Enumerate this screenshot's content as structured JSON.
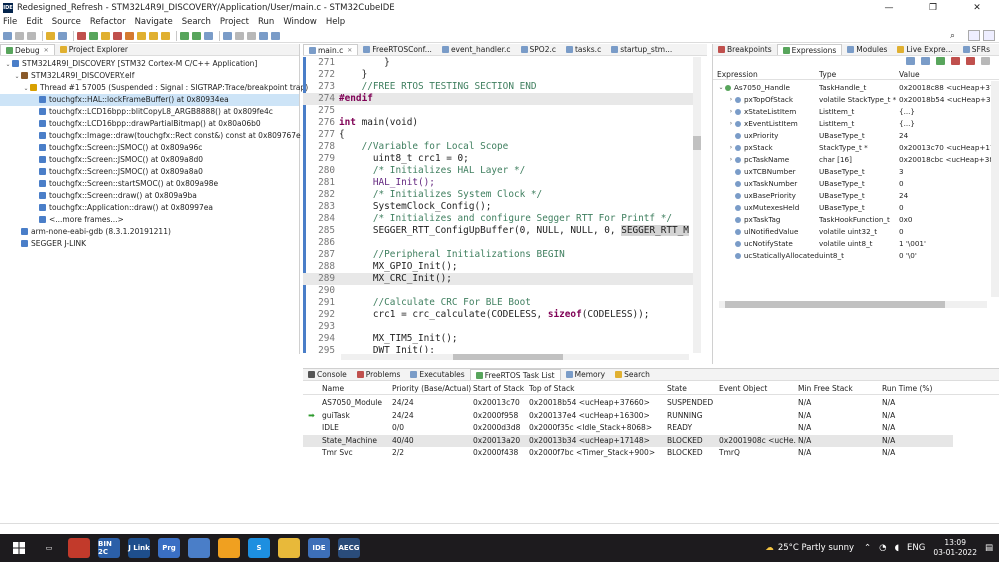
{
  "window": {
    "title": "Redesigned_Refresh - STM32L4R9I_DISCOVERY/Application/User/main.c - STM32CubeIDE",
    "minimize": "—",
    "maximize": "❐",
    "close": "✕"
  },
  "menu": [
    "File",
    "Edit",
    "Source",
    "Refactor",
    "Navigate",
    "Search",
    "Project",
    "Run",
    "Window",
    "Help"
  ],
  "left_tabs": {
    "debug": "Debug",
    "explorer": "Project Explorer"
  },
  "debug_tree": [
    {
      "indent": 0,
      "tw": "⌄",
      "text": "STM32L4R9I_DISCOVERY [STM32 Cortex-M C/C++ Application]",
      "icon": "#4a7ec8"
    },
    {
      "indent": 1,
      "tw": "⌄",
      "text": "STM32L4R9I_DISCOVERY.elf",
      "icon": "#8a5a2a"
    },
    {
      "indent": 2,
      "tw": "⌄",
      "text": "Thread #1 57005 (Suspended : Signal : SIGTRAP:Trace/breakpoint trap)",
      "icon": "#d8a000"
    },
    {
      "indent": 3,
      "tw": "",
      "text": "touchgfx::HAL::lockFrameBuffer() at 0x80934ea",
      "icon": "#4a7ec8",
      "sel": true
    },
    {
      "indent": 3,
      "tw": "",
      "text": "touchgfx::LCD16bpp::blitCopyL8_ARGB8888() at 0x809fe4c",
      "icon": "#4a7ec8"
    },
    {
      "indent": 3,
      "tw": "",
      "text": "touchgfx::LCD16bpp::drawPartialBitmap() at 0x80a06b0",
      "icon": "#4a7ec8"
    },
    {
      "indent": 3,
      "tw": "",
      "text": "touchgfx::Image::draw(touchgfx::Rect const&) const at 0x809767e",
      "icon": "#4a7ec8"
    },
    {
      "indent": 3,
      "tw": "",
      "text": "touchgfx::Screen::JSMOC() at 0x809a96c",
      "icon": "#4a7ec8"
    },
    {
      "indent": 3,
      "tw": "",
      "text": "touchgfx::Screen::JSMOC() at 0x809a8d0",
      "icon": "#4a7ec8"
    },
    {
      "indent": 3,
      "tw": "",
      "text": "touchgfx::Screen::JSMOC() at 0x809a8a0",
      "icon": "#4a7ec8"
    },
    {
      "indent": 3,
      "tw": "",
      "text": "touchgfx::Screen::startSMOC() at 0x809a98e",
      "icon": "#4a7ec8"
    },
    {
      "indent": 3,
      "tw": "",
      "text": "touchgfx::Screen::draw() at 0x809a9ba",
      "icon": "#4a7ec8"
    },
    {
      "indent": 3,
      "tw": "",
      "text": "touchgfx::Application::draw() at 0x80997ea",
      "icon": "#4a7ec8"
    },
    {
      "indent": 3,
      "tw": "",
      "text": "<...more frames...>",
      "icon": "#4a7ec8"
    },
    {
      "indent": 1,
      "tw": "",
      "text": "arm-none-eabi-gdb (8.3.1.20191211)",
      "icon": "#4a7ec8"
    },
    {
      "indent": 1,
      "tw": "",
      "text": "SEGGER J-LINK",
      "icon": "#4a7ec8"
    }
  ],
  "editor_tabs": [
    "main.c",
    "FreeRTOSConf...",
    "event_handler.c",
    "SPO2.c",
    "tasks.c",
    "startup_stm..."
  ],
  "code": [
    {
      "n": "271",
      "t": "        }"
    },
    {
      "n": "272",
      "t": "    }"
    },
    {
      "n": "273",
      "t": "    //FREE RTOS TESTING SECTION END",
      "c": "cm"
    },
    {
      "n": "274",
      "t": "#endif",
      "c": "pp",
      "hl": true
    },
    {
      "n": "275",
      "t": ""
    },
    {
      "n": "276",
      "t": "int main(void)",
      "k": "int"
    },
    {
      "n": "277",
      "t": "{"
    },
    {
      "n": "278",
      "t": "    //Variable for Local Scope",
      "c": "cm"
    },
    {
      "n": "279",
      "t": "      uint8_t crc1 = 0;"
    },
    {
      "n": "280",
      "t": "      /* Initializes HAL Layer */",
      "c": "cm"
    },
    {
      "n": "281",
      "t": "      HAL_Init();",
      "c": "mc"
    },
    {
      "n": "282",
      "t": "      /* Initializes System Clock */",
      "c": "cm"
    },
    {
      "n": "283",
      "t": "      SystemClock_Config();"
    },
    {
      "n": "284",
      "t": "      /* Initializes and configure Segger RTT For Printf */",
      "c": "cm"
    },
    {
      "n": "285",
      "t": "      SEGGER_RTT_ConfigUpBuffer(0, NULL, NULL, 0, SEGGER_RTT_M"
    },
    {
      "n": "286",
      "t": ""
    },
    {
      "n": "287",
      "t": "      //Peripheral Initializations BEGIN",
      "c": "cm"
    },
    {
      "n": "288",
      "t": "      MX_GPIO_Init();"
    },
    {
      "n": "289",
      "t": "      MX_CRC_Init();",
      "hl": true
    },
    {
      "n": "290",
      "t": ""
    },
    {
      "n": "291",
      "t": "      //Calculate CRC For BLE Boot",
      "c": "cm"
    },
    {
      "n": "292",
      "t": "      crc1 = crc_calculate(CODELESS, sizeof(CODELESS));"
    },
    {
      "n": "293",
      "t": ""
    },
    {
      "n": "294",
      "t": "      MX_TIM5_Init();"
    },
    {
      "n": "295",
      "t": "      DWT_Init();"
    }
  ],
  "right_tabs": [
    "Breakpoints",
    "Expressions",
    "Modules",
    "Live Expre...",
    "SFRs"
  ],
  "expr_headers": {
    "expr": "Expression",
    "type": "Type",
    "value": "Value"
  },
  "expr_rows": [
    {
      "tw": "⌄",
      "name": "As7050_Handle",
      "type": "TaskHandle_t",
      "value": "0x20018c88 <ucHeap+379",
      "lvl": 0
    },
    {
      "tw": "›",
      "name": "pxTopOfStack",
      "type": "volatile StackType_t *",
      "value": "0x20018b54 <ucHeap+37",
      "lvl": 1
    },
    {
      "tw": "›",
      "name": "xStateListItem",
      "type": "ListItem_t",
      "value": "{...}",
      "lvl": 1
    },
    {
      "tw": "›",
      "name": "xEventListItem",
      "type": "ListItem_t",
      "value": "{...}",
      "lvl": 1
    },
    {
      "tw": "",
      "name": "uxPriority",
      "type": "UBaseType_t",
      "value": "24",
      "lvl": 1
    },
    {
      "tw": "›",
      "name": "pxStack",
      "type": "StackType_t *",
      "value": "0x20013c70 <ucHeap+174",
      "lvl": 1
    },
    {
      "tw": "›",
      "name": "pcTaskName",
      "type": "char [16]",
      "value": "0x20018cbc <ucHeap+380",
      "lvl": 1
    },
    {
      "tw": "",
      "name": "uxTCBNumber",
      "type": "UBaseType_t",
      "value": "3",
      "lvl": 1
    },
    {
      "tw": "",
      "name": "uxTaskNumber",
      "type": "UBaseType_t",
      "value": "0",
      "lvl": 1
    },
    {
      "tw": "",
      "name": "uxBasePriority",
      "type": "UBaseType_t",
      "value": "24",
      "lvl": 1
    },
    {
      "tw": "",
      "name": "uxMutexesHeld",
      "type": "UBaseType_t",
      "value": "0",
      "lvl": 1
    },
    {
      "tw": "",
      "name": "pxTaskTag",
      "type": "TaskHookFunction_t",
      "value": "0x0",
      "lvl": 1
    },
    {
      "tw": "",
      "name": "ulNotifiedValue",
      "type": "volatile uint32_t",
      "value": "0",
      "lvl": 1
    },
    {
      "tw": "",
      "name": "ucNotifyState",
      "type": "volatile uint8_t",
      "value": "1 '\\001'",
      "lvl": 1
    },
    {
      "tw": "",
      "name": "ucStaticallyAllocated",
      "type": "uint8_t",
      "value": "0 '\\0'",
      "lvl": 1
    }
  ],
  "bottom_tabs": [
    "Console",
    "Problems",
    "Executables",
    "FreeRTOS Task List",
    "Memory",
    "Search"
  ],
  "task_headers": [
    "Name",
    "Priority (Base/Actual)",
    "Start of Stack",
    "Top of Stack",
    "State",
    "Event Object",
    "Min Free Stack",
    "Run Time (%)"
  ],
  "tasks": [
    {
      "name": "AS7050_Module",
      "prio": "24/24",
      "start": "0x20013c70",
      "top": "0x20018b54 <ucHeap+37660>",
      "state": "SUSPENDED",
      "event": "",
      "min": "N/A",
      "run": "N/A"
    },
    {
      "name": "guiTask",
      "prio": "24/24",
      "start": "0x2000f958",
      "top": "0x200137e4 <ucHeap+16300>",
      "state": "RUNNING",
      "event": "",
      "min": "N/A",
      "run": "N/A",
      "running": true
    },
    {
      "name": "IDLE",
      "prio": "0/0",
      "start": "0x2000d3d8",
      "top": "0x2000f35c <Idle_Stack+8068>",
      "state": "READY",
      "event": "",
      "min": "N/A",
      "run": "N/A"
    },
    {
      "name": "State_Machine",
      "prio": "40/40",
      "start": "0x20013a20",
      "top": "0x20013b34 <ucHeap+17148>",
      "state": "BLOCKED",
      "event": "0x2001908c <ucHe...",
      "min": "N/A",
      "run": "N/A",
      "sel": true
    },
    {
      "name": "Tmr Svc",
      "prio": "2/2",
      "start": "0x2000f438",
      "top": "0x2000f7bc <Timer_Stack+900>",
      "state": "BLOCKED",
      "event": "TmrQ",
      "min": "N/A",
      "run": "N/A"
    }
  ],
  "taskbar": {
    "apps": [
      {
        "label": "",
        "color": "#c23a2b",
        "name": "brave-icon"
      },
      {
        "label": "BIN 2C",
        "color": "#2b5fa8",
        "name": "bin2c-icon"
      },
      {
        "label": "J Link",
        "color": "#1e4e8c",
        "name": "jlink-icon"
      },
      {
        "label": "Prg",
        "color": "#3a6fc4",
        "name": "programmer-icon"
      },
      {
        "label": "",
        "color": "#4a7ec8",
        "name": "mail-icon"
      },
      {
        "label": "",
        "color": "#f0a020",
        "name": "search-app-icon"
      },
      {
        "label": "S",
        "color": "#1d8fe0",
        "name": "skype-icon"
      },
      {
        "label": "",
        "color": "#e8b93a",
        "name": "folder-icon"
      },
      {
        "label": "IDE",
        "color": "#3d6fb8",
        "name": "stm32cubeide-icon"
      },
      {
        "label": "AECG",
        "color": "#2a4c7a",
        "name": "aecg-icon"
      }
    ],
    "weather": "25°C  Partly sunny",
    "lang": "ENG",
    "time": "13:09",
    "date": "03-01-2022"
  }
}
